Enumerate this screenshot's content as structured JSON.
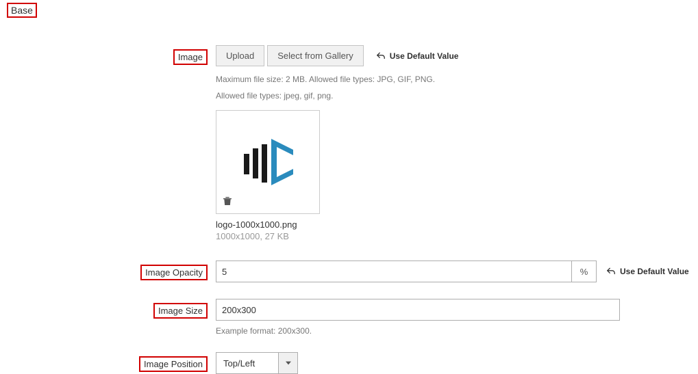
{
  "sectionTitle": "Base",
  "fields": {
    "image": {
      "label": "Image",
      "uploadLabel": "Upload",
      "galleryLabel": "Select from Gallery",
      "useDefault": "Use Default Value",
      "helper1": "Maximum file size: 2 MB. Allowed file types: JPG, GIF, PNG.",
      "helper2": "Allowed file types: jpeg, gif, png.",
      "filename": "logo-1000x1000.png",
      "filemeta": "1000x1000, 27 KB"
    },
    "opacity": {
      "label": "Image Opacity",
      "value": "5",
      "suffix": "%",
      "useDefault": "Use Default Value"
    },
    "size": {
      "label": "Image Size",
      "value": "200x300",
      "helper": "Example format: 200x300."
    },
    "position": {
      "label": "Image Position",
      "selected": "Top/Left"
    }
  }
}
